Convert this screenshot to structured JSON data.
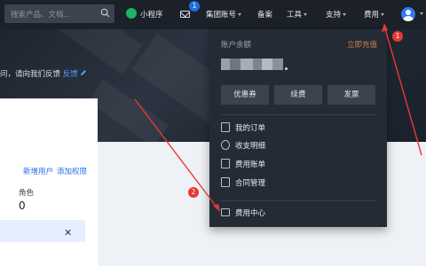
{
  "nav": {
    "search_placeholder": "搜索产品、文档...",
    "mini_program": "小程序",
    "mail_badge": "1",
    "group_account": "集团账号",
    "record": "备案",
    "tools": "工具",
    "support": "支持",
    "fees": "费用"
  },
  "banner": {
    "feedback_text": "问，请向我们反馈",
    "feedback_link": "反馈"
  },
  "card": {
    "link_new_user": "新增用户",
    "link_add_permission": "添加权限",
    "role_label": "角色",
    "role_value": "0"
  },
  "dropdown": {
    "balance_label": "账户余额",
    "recharge_link": "立即充值",
    "buttons": [
      "优惠券",
      "续费",
      "发票"
    ],
    "items": [
      "我的订单",
      "收支明细",
      "费用账单",
      "合同管理"
    ],
    "cost_center": "费用中心"
  },
  "annotations": {
    "badge_1": "1",
    "badge_2": "2",
    "arrow_color": "#e53935"
  },
  "colors": {
    "nav_bg": "#1b2029",
    "dropdown_bg": "#252b35",
    "link_blue": "#2b6de5",
    "recharge_orange": "#c9814a"
  }
}
